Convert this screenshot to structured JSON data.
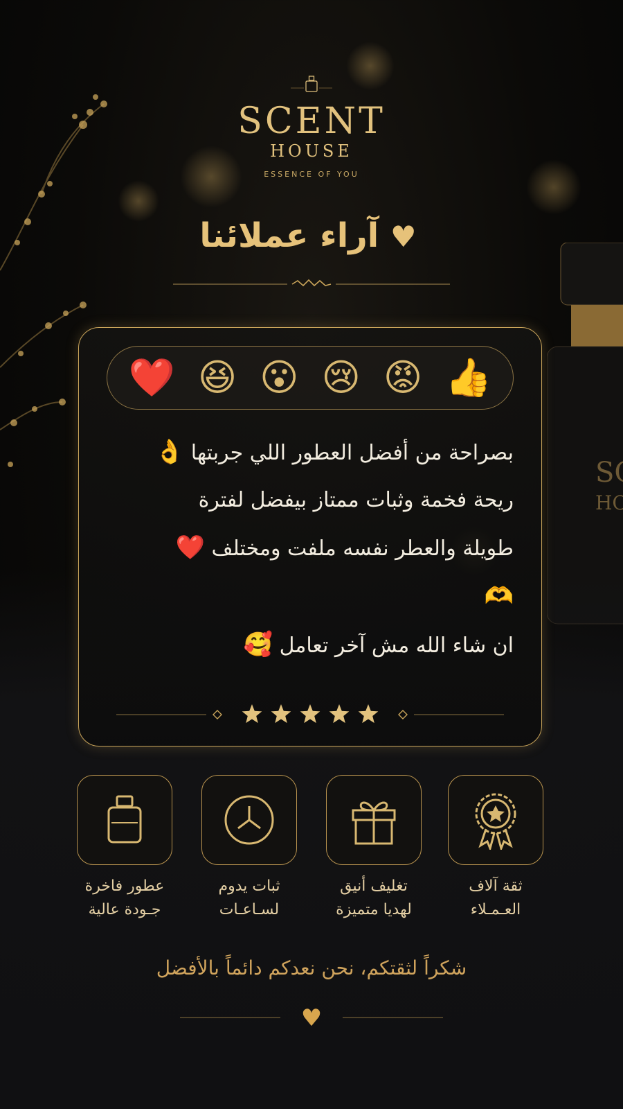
{
  "brand": {
    "name": "SCENT",
    "sub": "HOUSE",
    "tagline": "ESSENCE OF YOU"
  },
  "page_title": "آراء عملائنا",
  "title_heart": "♥",
  "emoji_bar": [
    "❤️",
    "😆",
    "😮",
    "😢",
    "😡",
    "👍"
  ],
  "review": {
    "lines": [
      {
        "text": "بصراحة من أفضل العطور اللي جربتها",
        "emoji": "👌"
      },
      {
        "text": "ريحة فخمة وثبات ممتاز بيفضل لفترة",
        "emoji": ""
      },
      {
        "text": "طويلة والعطر نفسه ملفت ومختلف",
        "emoji": "❤️"
      },
      {
        "text": "",
        "emoji": "🫶"
      },
      {
        "text": "ان شاء الله مش آخر تعامل",
        "emoji": "🥰"
      }
    ],
    "rating": 5
  },
  "features": [
    {
      "line1": "ثقة آلاف",
      "line2": "العـمـلاء",
      "icon": "award-badge-icon"
    },
    {
      "line1": "تغليف أنيق",
      "line2": "لهديا متميزة",
      "icon": "gift-box-icon"
    },
    {
      "line1": "ثبات يدوم",
      "line2": "لسـاعـات",
      "icon": "clock-icon"
    },
    {
      "line1": "عطور فاخرة",
      "line2": "جـودة عالية",
      "icon": "perfume-bottle-icon"
    }
  ],
  "thanks": "شكراً لثقتكم، نحن نعدكم دائماً بالأفضل",
  "footer_heart": "♥",
  "colors": {
    "gold": "#d8b871",
    "background": "#0b0a08",
    "text": "#f3ede0"
  }
}
